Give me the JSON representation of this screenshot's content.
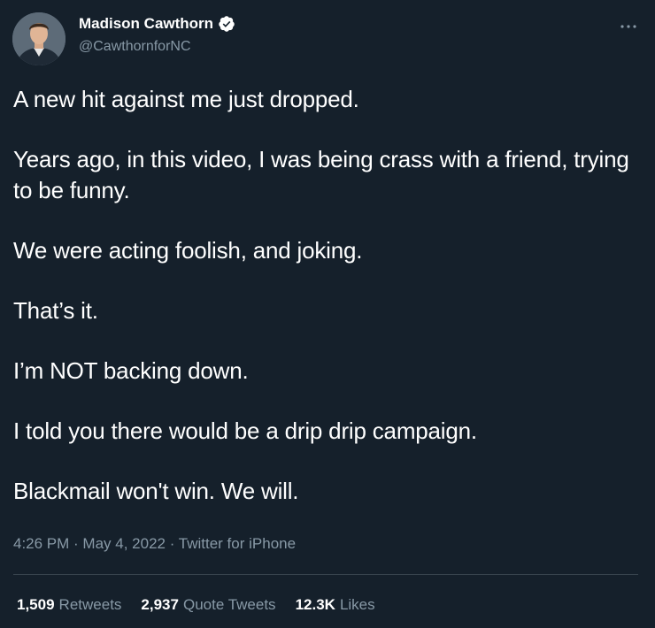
{
  "author": {
    "display_name": "Madison Cawthorn",
    "handle": "@CawthornforNC",
    "verified": true
  },
  "tweet": {
    "paragraphs": [
      "A new hit against me just dropped.",
      "Years ago, in this video, I was being crass with a friend, trying to be funny.",
      "We were acting foolish, and joking.",
      "That’s it.",
      "I’m NOT backing down.",
      "I told you there would be a drip drip campaign.",
      "Blackmail won't win. We will."
    ],
    "meta": "4:26 PM · May 4, 2022 · Twitter for iPhone"
  },
  "stats": {
    "retweets": {
      "count": "1,509",
      "label": "Retweets"
    },
    "quotes": {
      "count": "2,937",
      "label": "Quote Tweets"
    },
    "likes": {
      "count": "12.3K",
      "label": "Likes"
    }
  },
  "icons": {
    "verified": "verified-badge-icon",
    "more": "more-options-icon"
  },
  "colors": {
    "background": "#15202b",
    "text": "#ffffff",
    "secondary_text": "#8899a6",
    "divider": "#38444d",
    "verified_badge": "#ffffff"
  }
}
